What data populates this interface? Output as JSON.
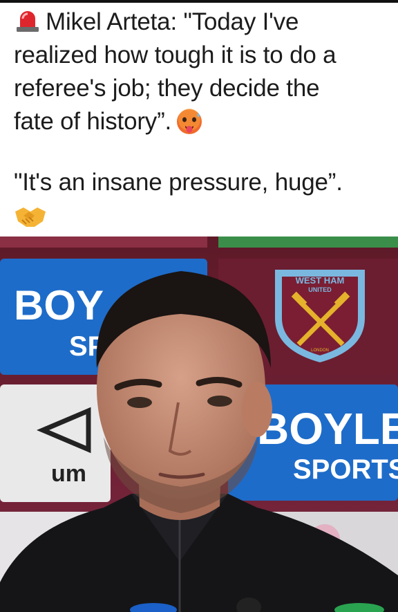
{
  "post": {
    "lines": [
      "Mikel Arteta: \"Today I've",
      "realized how tough it is to do a",
      "referee's job; they decide the",
      "fate of history”."
    ],
    "quote2": "\"It's an insane pressure, huge”.",
    "emoji_siren": "police-car-light-emoji",
    "emoji_hot": "hot-face-emoji",
    "emoji_handshake": "handshake-emoji"
  },
  "photo": {
    "sponsor_top_left": "BOY",
    "sponsor_top_left_sub": "SP",
    "sponsor_right": "BOYLE",
    "sponsor_right_sub": "SPORTS",
    "kit_brand": "um",
    "crest_top": "WEST HAM",
    "crest_sub": "UNITED",
    "crest_bottom": "LONDON",
    "colors": {
      "maroon": "#7a2236",
      "sponsor_blue": "#1f6fd0",
      "crest_claret": "#7b1e33",
      "crest_blue": "#7ab8e0",
      "gold": "#e5b22b"
    }
  }
}
